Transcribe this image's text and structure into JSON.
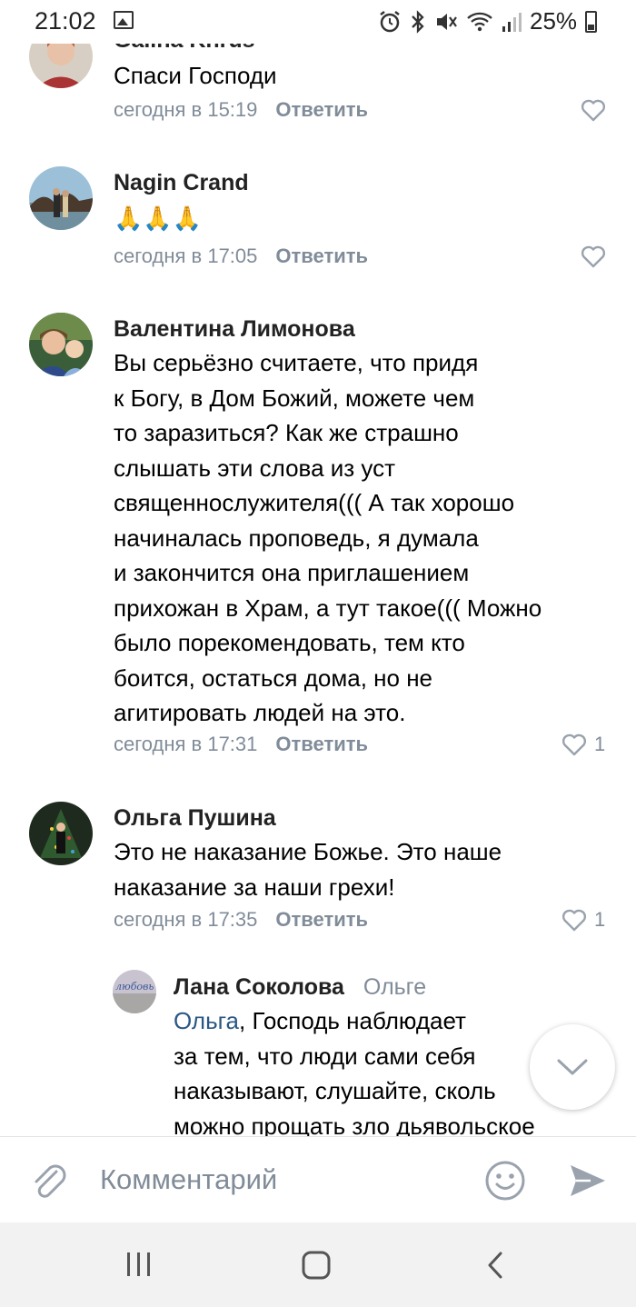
{
  "status_bar": {
    "time": "21:02",
    "battery": "25%",
    "icons": [
      "gallery-icon",
      "alarm-icon",
      "bluetooth-icon",
      "mute-icon",
      "wifi-icon",
      "signal-icon",
      "battery-icon"
    ]
  },
  "comments": [
    {
      "author": "Galina Khrus",
      "text": "Спаси Господи",
      "time": "сегодня в 15:19",
      "reply_label": "Ответить",
      "likes": ""
    },
    {
      "author": "Nagin Crand",
      "text": "🙏🙏🙏",
      "time": "сегодня в 17:05",
      "reply_label": "Ответить",
      "likes": ""
    },
    {
      "author": "Валентина Лимонова",
      "text": "Вы серьёзно считаете, что придя\nк Богу, в Дом Божий, можете чем\nто заразиться? Как  же страшно\nслышать эти слова из уст\nсвященнослужителя((( А так хорошо\nначиналась проповедь, я думала\nи закончится она приглашением\nприхожан в Храм, а тут такое((( Можно\nбыло порекомендовать, тем кто\nбоится, остаться дома, но не\nагитировать людей на это.",
      "time": "сегодня в 17:31",
      "reply_label": "Ответить",
      "likes": "1"
    },
    {
      "author": "Ольга Пушина",
      "text": "Это не наказание Божье. Это наше\nнаказание за наши грехи!",
      "time": "сегодня в 17:35",
      "reply_label": "Ответить",
      "likes": "1"
    }
  ],
  "reply": {
    "author": "Лана Соколова",
    "reply_to": "Ольге",
    "mention": "Ольга",
    "text": ", Господь наблюдает\nза тем, что люди сами себя\nнаказывают, слушайте, сколь\nможно прощать зло дьявольское",
    "avatar_text": "любовь"
  },
  "composer": {
    "placeholder": "Комментарий"
  },
  "colors": {
    "meta": "#818c99",
    "link": "#2a5885",
    "icon_gray": "#99a2ad"
  }
}
